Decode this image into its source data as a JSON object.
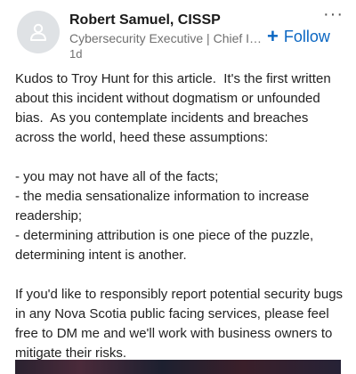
{
  "author": {
    "name": "Robert Samuel, CISSP",
    "headline": "Cybersecurity Executive | Chief Infor…",
    "time": "1d"
  },
  "actions": {
    "more": "···",
    "follow_icon": "+",
    "follow_label": "Follow"
  },
  "post": {
    "paragraphs": [
      "Kudos to Troy Hunt for this article.  It's the first written about this incident without dogmatism or unfounded bias.  As you contemplate incidents and breaches across the world, heed these assumptions:",
      "- you may not have all of the facts;\n- the media sensationalize information to increase readership;\n- determining attribution is one piece of the puzzle, determining intent is another.",
      "If you'd like to responsibly report potential security bugs in any Nova Scotia public facing services, please feel free to DM me and we'll work with business owners to mitigate their risks."
    ]
  },
  "colors": {
    "accent": "#0a66c2",
    "avatar_bg": "#dfe2e5",
    "secondary_text": "#707070"
  },
  "icons": {
    "avatar": "person-silhouette-icon",
    "more": "more-options-icon",
    "follow": "plus-icon"
  }
}
